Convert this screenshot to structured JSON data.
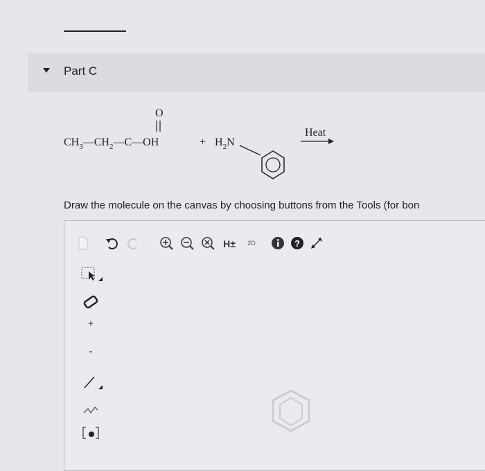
{
  "section": {
    "title": "Part C"
  },
  "reaction": {
    "reactant1": "CH3—CH2—C—OH",
    "carbonyl_oxygen": "O",
    "plus": "+",
    "reactant2_amine": "H2N",
    "condition": "Heat"
  },
  "instruction": "Draw the molecule on the canvas by choosing buttons from the Tools (for bon",
  "toolbar": {
    "items": [
      {
        "name": "new-document-icon"
      },
      {
        "name": "undo-icon"
      },
      {
        "name": "redo-icon"
      },
      {
        "name": "zoom-in-icon"
      },
      {
        "name": "zoom-out-icon"
      },
      {
        "name": "reset-zoom-icon"
      },
      {
        "name": "explicit-hydrogens-icon",
        "label": "H±"
      },
      {
        "name": "2d-view-icon",
        "label": "2D"
      },
      {
        "name": "info-icon"
      },
      {
        "name": "help-icon"
      },
      {
        "name": "fullscreen-icon"
      }
    ]
  },
  "side_tools": [
    {
      "name": "select-tool-icon"
    },
    {
      "name": "eraser-icon"
    },
    {
      "name": "positive-charge-icon",
      "label": "+"
    },
    {
      "name": "negative-charge-icon",
      "label": "-"
    },
    {
      "name": "single-bond-icon"
    },
    {
      "name": "chain-tool-icon"
    },
    {
      "name": "bracket-tool-icon"
    }
  ]
}
